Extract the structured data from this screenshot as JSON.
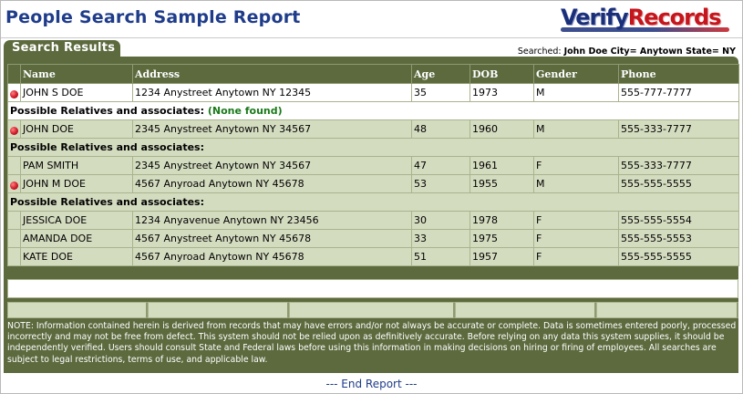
{
  "header": {
    "title": "People Search Sample Report",
    "logo_part1": "Verify",
    "logo_part2": "Records"
  },
  "tab_label": "Search Results",
  "searched": {
    "label": "Searched:",
    "value": "John Doe City= Anytown State= NY"
  },
  "columns": [
    "Name",
    "Address",
    "Age",
    "DOB",
    "Gender",
    "Phone"
  ],
  "rows": [
    {
      "name": "JOHN S DOE",
      "address": "1234 Anystreet Anytown NY 12345",
      "age": "35",
      "dob": "1973",
      "gender": "M",
      "phone": "555-777-7777"
    },
    {
      "label": "Possible Relatives and associates:",
      "note": "(None found)"
    },
    {
      "name": "JOHN DOE",
      "address": "2345 Anystreet Anytown NY 34567",
      "age": "48",
      "dob": "1960",
      "gender": "M",
      "phone": "555-333-7777"
    },
    {
      "label": "Possible Relatives and associates:"
    },
    {
      "name": "PAM SMITH",
      "address": "2345 Anystreet Anytown NY 34567",
      "age": "47",
      "dob": "1961",
      "gender": "F",
      "phone": "555-333-7777"
    },
    {
      "name": "JOHN M DOE",
      "address": "4567 Anyroad Anytown  NY 45678",
      "age": "53",
      "dob": "1955",
      "gender": "M",
      "phone": "555-555-5555"
    },
    {
      "label": "Possible Relatives and associates:"
    },
    {
      "name": "JESSICA DOE",
      "address": "1234 Anyavenue  Anytown NY 23456",
      "age": "30",
      "dob": "1978",
      "gender": "F",
      "phone": "555-555-5554"
    },
    {
      "name": "AMANDA DOE",
      "address": "4567 Anystreet  Anytown NY 45678",
      "age": "33",
      "dob": "1975",
      "gender": "F",
      "phone": "555-555-5553"
    },
    {
      "name": "KATE DOE",
      "address": "4567 Anyroad Anytown  NY 45678",
      "age": "51",
      "dob": "1957",
      "gender": "F",
      "phone": "555-555-5555"
    }
  ],
  "disclaimer": "NOTE: Information contained herein is derived from records that may have errors and/or not always be accurate or complete. Data is sometimes entered poorly, processed incorrectly and may not be free from defect.  This system should not be relied upon as definitively accurate.  Before relying on any data this system supplies, it should be independently verified. Users should consult State and Federal laws before using this information in making decisions on hiring or firing of employees. All searches are subject to legal restrictions, terms of use, and applicable law.",
  "end_report": "--- End Report ---",
  "colors": {
    "olive": "#5c6a3e",
    "row_green": "#d4dcc0",
    "title_blue": "#1f3c8a",
    "accent_red": "#c4161c",
    "none_found_green": "#1a7a1a"
  },
  "icons": {
    "primary_marker": "red-bullet-icon"
  }
}
